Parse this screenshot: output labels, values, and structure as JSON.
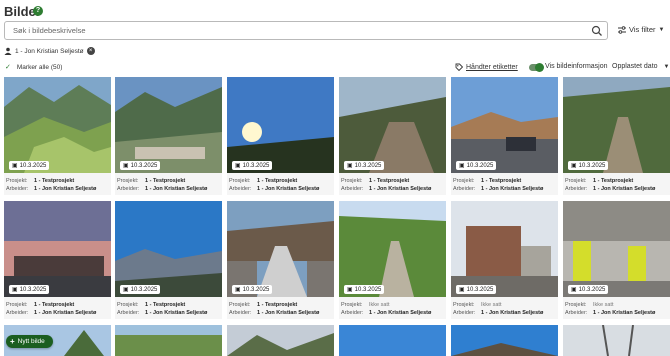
{
  "header": {
    "title": "Bilder",
    "help_icon": "help-icon"
  },
  "search": {
    "placeholder": "Søk i bildebeskrivelse"
  },
  "filter": {
    "label": "Vis filter"
  },
  "active_filter": {
    "label": "1 - Jon Kristian Seljestø"
  },
  "toolbar": {
    "select_all": "Marker alle (50)",
    "manage_tags": "Håndter etiketter",
    "show_info": "Vis bildeinformasjon",
    "sort": "Opplastet dato"
  },
  "meta_labels": {
    "project": "Prosjekt:",
    "worker": "Arbeider:"
  },
  "cards": [
    {
      "date": "10.3.2025",
      "project": "1 - Testprosjekt",
      "worker": "1 - Jon Kristian Seljestø",
      "project_muted": false
    },
    {
      "date": "10.3.2025",
      "project": "1 - Testprosjekt",
      "worker": "1 - Jon Kristian Seljestø",
      "project_muted": false
    },
    {
      "date": "10.3.2025",
      "project": "1 - Testprosjekt",
      "worker": "1 - Jon Kristian Seljestø",
      "project_muted": false
    },
    {
      "date": "10.3.2025",
      "project": "1 - Testprosjekt",
      "worker": "1 - Jon Kristian Seljestø",
      "project_muted": false
    },
    {
      "date": "10.3.2025",
      "project": "1 - Testprosjekt",
      "worker": "1 - Jon Kristian Seljestø",
      "project_muted": false
    },
    {
      "date": "10.3.2025",
      "project": "1 - Testprosjekt",
      "worker": "1 - Jon Kristian Seljestø",
      "project_muted": false
    },
    {
      "date": "10.3.2025",
      "project": "1 - Testprosjekt",
      "worker": "1 - Jon Kristian Seljestø",
      "project_muted": false
    },
    {
      "date": "10.3.2025",
      "project": "1 - Testprosjekt",
      "worker": "1 - Jon Kristian Seljestø",
      "project_muted": false
    },
    {
      "date": "10.3.2025",
      "project": "1 - Testprosjekt",
      "worker": "1 - Jon Kristian Seljestø",
      "project_muted": false
    },
    {
      "date": "10.3.2025",
      "project": "Ikke satt",
      "worker": "1 - Jon Kristian Seljestø",
      "project_muted": true
    },
    {
      "date": "10.3.2025",
      "project": "Ikke satt",
      "worker": "1 - Jon Kristian Seljestø",
      "project_muted": true
    },
    {
      "date": "10.3.2025",
      "project": "Ikke satt",
      "worker": "1 - Jon Kristian Seljestø",
      "project_muted": true
    }
  ],
  "fab": {
    "label": "Nytt bilde"
  },
  "colors": {
    "accent": "#2e7d32",
    "fab": "#1b5e20"
  }
}
